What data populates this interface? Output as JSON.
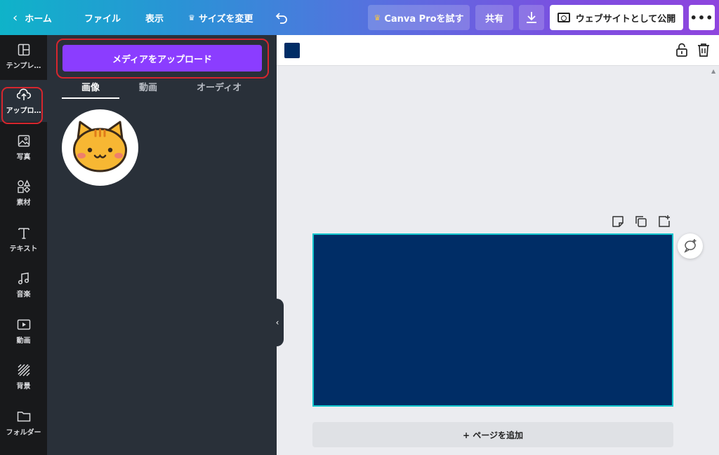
{
  "topbar": {
    "back_label": "ホーム",
    "file_label": "ファイル",
    "view_label": "表示",
    "resize_label": "サイズを変更",
    "pro_label": "Canva Proを試す",
    "share_label": "共有",
    "publish_label": "ウェブサイトとして公開",
    "more_label": "•••"
  },
  "rail": {
    "items": [
      {
        "label": "テンプレ…",
        "icon": "template-icon"
      },
      {
        "label": "アップロ…",
        "icon": "upload-cloud-icon"
      },
      {
        "label": "写真",
        "icon": "photo-icon"
      },
      {
        "label": "素材",
        "icon": "elements-icon"
      },
      {
        "label": "テキスト",
        "icon": "text-icon"
      },
      {
        "label": "音楽",
        "icon": "music-icon"
      },
      {
        "label": "動画",
        "icon": "video-icon"
      },
      {
        "label": "背景",
        "icon": "background-icon"
      },
      {
        "label": "フォルダー",
        "icon": "folder-icon"
      }
    ]
  },
  "panel": {
    "upload_button_label": "メディアをアップロード",
    "tabs": [
      {
        "label": "画像"
      },
      {
        "label": "動画"
      },
      {
        "label": "オーディオ"
      }
    ],
    "uploaded_items": [
      {
        "icon": "cat-face-image"
      }
    ]
  },
  "canvas": {
    "page_color": "#002D66",
    "add_page_label": "+ ページを追加"
  },
  "colors": {
    "accent": "#8B3DFF",
    "selection": "#00C4CC",
    "highlight": "#D6262E"
  }
}
